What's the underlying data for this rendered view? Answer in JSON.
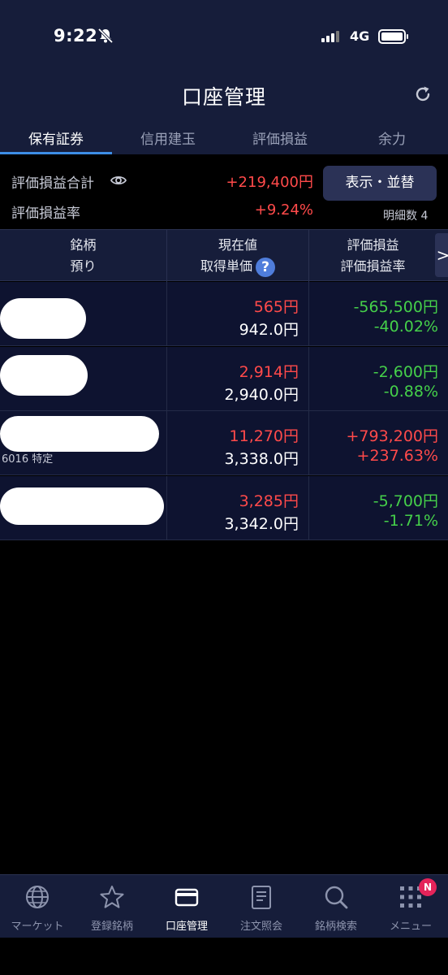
{
  "status_bar": {
    "time": "9:22",
    "network": "4G"
  },
  "header": {
    "title": "口座管理"
  },
  "tabs": [
    {
      "label": "保有証券",
      "active": true
    },
    {
      "label": "信用建玉",
      "active": false
    },
    {
      "label": "評価損益",
      "active": false
    },
    {
      "label": "余力",
      "active": false
    }
  ],
  "summary": {
    "total_label": "評価損益合計",
    "total_value": "+219,400円",
    "rate_label": "評価損益率",
    "rate_value": "+9.24%",
    "sort_button": "表示・並替",
    "detail_label": "明細数",
    "detail_count": "4"
  },
  "table": {
    "headers": {
      "col1_line1": "銘柄",
      "col1_line2": "預り",
      "col2_line1": "現在値",
      "col2_line2": "取得単価",
      "col3_line1": "評価損益",
      "col3_line2": "評価損益率"
    },
    "next_arrow": ">",
    "rows": [
      {
        "price": "565円",
        "cost": "942.0円",
        "pl": "-565,500円",
        "rate": "-40.02%",
        "snippet": ""
      },
      {
        "price": "2,914円",
        "cost": "2,940.0円",
        "pl": "-2,600円",
        "rate": "-0.88%",
        "snippet": ""
      },
      {
        "price": "11,270円",
        "cost": "3,338.0円",
        "pl": "+793,200円",
        "rate": "+237.63%",
        "snippet": "6016 特定"
      },
      {
        "price": "3,285円",
        "cost": "3,342.0円",
        "pl": "-5,700円",
        "rate": "-1.71%",
        "snippet": ""
      }
    ]
  },
  "bottom_nav": [
    {
      "label": "マーケット",
      "icon": "globe-icon"
    },
    {
      "label": "登録銘柄",
      "icon": "star-icon"
    },
    {
      "label": "口座管理",
      "icon": "card-icon",
      "active": true
    },
    {
      "label": "注文照会",
      "icon": "document-icon"
    },
    {
      "label": "銘柄検索",
      "icon": "search-icon"
    },
    {
      "label": "メニュー",
      "icon": "grid-icon",
      "badge": "N"
    }
  ],
  "colors": {
    "gain": "#ff4a4a",
    "loss": "#45d04a",
    "accent": "#3d8ee6",
    "navy": "#161d3a"
  }
}
